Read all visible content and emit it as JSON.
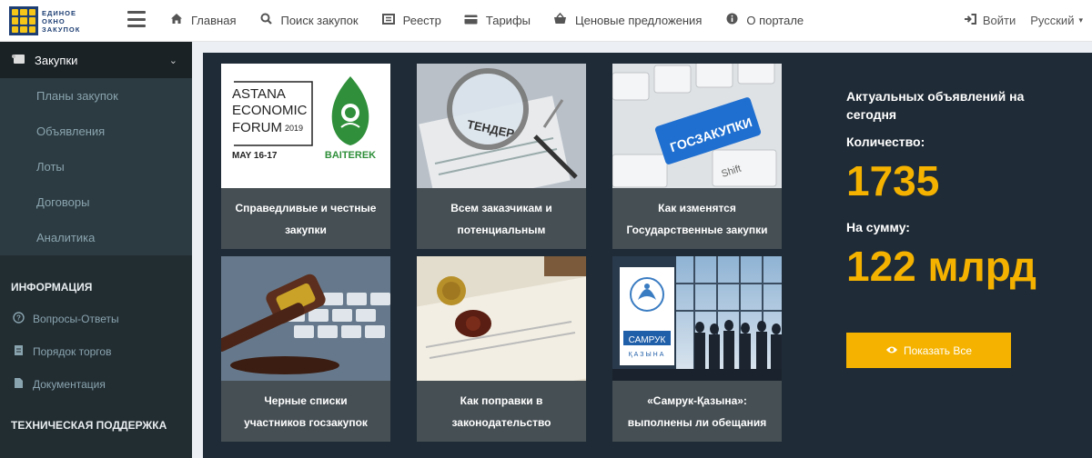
{
  "logo": {
    "line1": "ЕДИНОЕ",
    "line2": "ОКНО",
    "line3": "ЗАКУПОК"
  },
  "nav": [
    {
      "label": "Главная",
      "icon": "home-icon",
      "glyph": "⌂"
    },
    {
      "label": "Поиск закупок",
      "icon": "search-icon",
      "glyph": "🔍"
    },
    {
      "label": "Реестр",
      "icon": "registry-icon",
      "glyph": "▤"
    },
    {
      "label": "Тарифы",
      "icon": "tariff-icon",
      "glyph": "▬"
    },
    {
      "label": "Ценовые предложения",
      "icon": "basket-icon",
      "glyph": "🧺"
    },
    {
      "label": "О портале",
      "icon": "info-icon",
      "glyph": "ℹ"
    }
  ],
  "right": {
    "login": "Войти",
    "language": "Русский"
  },
  "sidebar": {
    "top": "Закупки",
    "subitems": [
      "Планы закупок",
      "Объявления",
      "Лоты",
      "Договоры",
      "Аналитика"
    ],
    "info_header": "ИНФОРМАЦИЯ",
    "info_items": [
      {
        "label": "Вопросы-Ответы",
        "icon": "question-icon",
        "glyph": "?"
      },
      {
        "label": "Порядок торгов",
        "icon": "document-icon",
        "glyph": "▭"
      },
      {
        "label": "Документация",
        "icon": "file-icon",
        "glyph": "▯"
      }
    ],
    "tech_header": "ТЕХНИЧЕСКАЯ ПОДДЕРЖКА"
  },
  "cards": [
    {
      "caption": "Справедливые и честные закупки",
      "image": "astana-forum-logo",
      "img_text": [
        "ASTANA",
        "ECONOMIC",
        "FORUM",
        "2019",
        "MAY 16-17",
        "BAITEREK"
      ]
    },
    {
      "caption": "Всем заказчикам и потенциальным",
      "image": "magnifier-tender",
      "img_text": [
        "ТЕНДЕР"
      ]
    },
    {
      "caption": "Как изменятся Государственные закупки",
      "image": "keyboard-goszakupki",
      "img_text": [
        "ГОСЗАКУПКИ",
        "Shift"
      ]
    },
    {
      "caption": "Черные списки участников госзакупок",
      "image": "gavel-keyboard",
      "img_text": []
    },
    {
      "caption": "Как поправки в законодательство",
      "image": "wax-seal",
      "img_text": []
    },
    {
      "caption": "«Самрук-Қазына»: выполнены ли обещания",
      "image": "samruk-kazyna",
      "img_text": [
        "САМРУК",
        "ҚАЗЫНА"
      ]
    }
  ],
  "stats": {
    "title": "Актуальных объявлений на сегодня",
    "count_label": "Количество:",
    "count": "1735",
    "sum_label": "На сумму:",
    "sum": "122 млрд",
    "button": "Показать Все"
  },
  "colors": {
    "accent": "#f5b300",
    "sidebar": "#222d32",
    "panel": "#1f2b36",
    "brand": "#1d3e73"
  }
}
